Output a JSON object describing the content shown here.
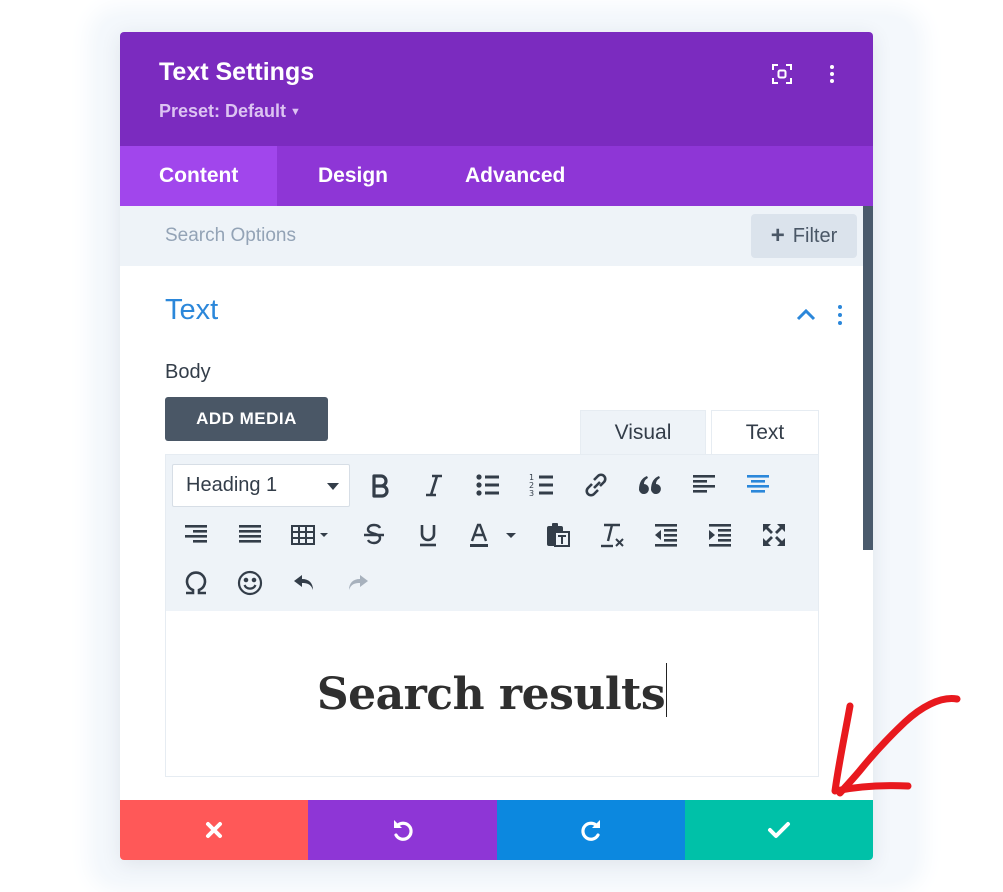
{
  "modal": {
    "title": "Text Settings",
    "preset_label": "Preset: Default",
    "header_icons": [
      "fullscreen-icon",
      "more-vertical-icon"
    ]
  },
  "tabs": [
    {
      "label": "Content",
      "active": true
    },
    {
      "label": "Design",
      "active": false
    },
    {
      "label": "Advanced",
      "active": false
    }
  ],
  "search": {
    "placeholder": "Search Options",
    "value": ""
  },
  "filter": {
    "label": "Filter"
  },
  "section": {
    "title": "Text"
  },
  "body": {
    "label": "Body",
    "add_media_label": "ADD MEDIA",
    "editor_tabs": [
      {
        "label": "Visual",
        "active": true
      },
      {
        "label": "Text",
        "active": false
      }
    ],
    "format_select": {
      "value": "Heading 1"
    },
    "toolbar_icons": [
      "bold-icon",
      "italic-icon",
      "bullet-list-icon",
      "numbered-list-icon",
      "link-icon",
      "blockquote-icon",
      "align-left-icon",
      "align-center-icon",
      "align-right-icon",
      "align-justify-icon",
      "table-icon",
      "strikethrough-icon",
      "underline-icon",
      "text-color-icon",
      "paste-text-icon",
      "clear-formatting-icon",
      "outdent-icon",
      "indent-icon",
      "fullscreen-icon",
      "omega-icon",
      "emoji-icon",
      "undo-icon",
      "redo-icon"
    ],
    "content": "Search results"
  },
  "footer": {
    "buttons": [
      {
        "name": "cancel",
        "icon": "close-icon",
        "color": "#ff5858"
      },
      {
        "name": "undo",
        "icon": "undo-icon",
        "color": "#8e36d6"
      },
      {
        "name": "redo",
        "icon": "redo-icon",
        "color": "#0c88df"
      },
      {
        "name": "save",
        "icon": "check-icon",
        "color": "#00c1a8"
      }
    ]
  },
  "colors": {
    "header": "#7b2bbf",
    "tabs_bar": "#8e36d6",
    "active_tab": "#a146ec",
    "section_title": "#2b87da",
    "annotation_arrow": "#e8191e"
  }
}
